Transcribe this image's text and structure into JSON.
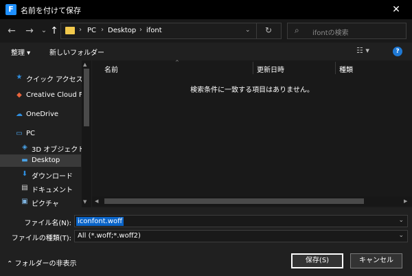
{
  "window": {
    "title": "名前を付けて保存",
    "close_glyph": "✕"
  },
  "nav": {
    "back_glyph": "←",
    "forward_glyph": "→",
    "recent_glyph": "⌄",
    "up_glyph": "↑",
    "breadcrumb": [
      "PC",
      "Desktop",
      "ifont"
    ],
    "separator": "›",
    "refresh_glyph": "↻",
    "search_placeholder": "ifontの検索"
  },
  "toolbar": {
    "organize_label": "整理 ▾",
    "new_folder_label": "新しいフォルダー",
    "view_glyph": "☷ ▾",
    "help_glyph": "?"
  },
  "sidebar": {
    "items": [
      {
        "label": "クイック アクセス",
        "icon": "star-icon",
        "glyph": "★",
        "color": "#2f8fe0"
      },
      {
        "label": "Creative Cloud File",
        "icon": "creative-cloud-icon",
        "glyph": "◆",
        "color": "#e8643c"
      },
      {
        "label": "OneDrive",
        "icon": "cloud-icon",
        "glyph": "☁",
        "color": "#2f8fe0"
      },
      {
        "label": "PC",
        "icon": "computer-icon",
        "glyph": "▭",
        "color": "#4aa3e8"
      },
      {
        "label": "3D オブジェクト",
        "icon": "cube-icon",
        "glyph": "◈",
        "color": "#4aa3e8"
      },
      {
        "label": "Desktop",
        "icon": "desktop-icon",
        "glyph": "▬",
        "color": "#4aa3e8"
      },
      {
        "label": "ダウンロード",
        "icon": "download-icon",
        "glyph": "⬇",
        "color": "#2f8fe0"
      },
      {
        "label": "ドキュメント",
        "icon": "document-icon",
        "glyph": "▤",
        "color": "#d9d9d9"
      },
      {
        "label": "ピクチャ",
        "icon": "picture-icon",
        "glyph": "▣",
        "color": "#7fb4e0"
      }
    ]
  },
  "file_list": {
    "columns": [
      "名前",
      "更新日時",
      "種類"
    ],
    "sort_glyph": "^",
    "empty_message": "検索条件に一致する項目はありません。"
  },
  "scroll": {
    "up": "▲",
    "down": "▼",
    "left": "◀",
    "right": "▶"
  },
  "form": {
    "filename_label": "ファイル名(N):",
    "filename_value": "iconfont.woff",
    "filetype_label": "ファイルの種類(T):",
    "filetype_value": "All (*.woff;*.woff2)",
    "dropdown_glyph": "⌄"
  },
  "footer": {
    "hide_folders_label": "⌃  フォルダーの非表示",
    "save_label": "保存(S)",
    "cancel_label": "キャンセル"
  }
}
